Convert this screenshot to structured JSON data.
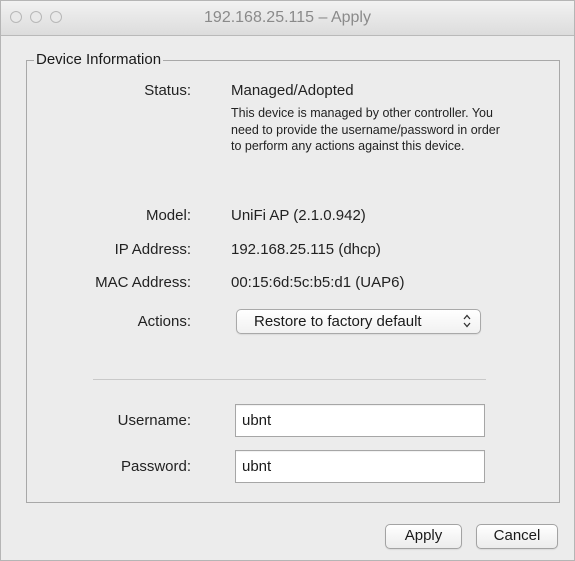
{
  "window": {
    "title": "192.168.25.115 – Apply"
  },
  "device_info": {
    "group_label": "Device Information",
    "status_label": "Status:",
    "status_value": "Managed/Adopted",
    "status_note": "This device is managed by other controller. You need to provide the username/password in order to perform any actions against this device.",
    "model_label": "Model:",
    "model_value": "UniFi AP (2.1.0.942)",
    "ip_label": "IP Address:",
    "ip_value": "192.168.25.115 (dhcp)",
    "mac_label": "MAC Address:",
    "mac_value": "00:15:6d:5c:b5:d1 (UAP6)",
    "actions_label": "Actions:",
    "actions_selected": "Restore to factory default"
  },
  "credentials": {
    "username_label": "Username:",
    "username_value": "ubnt",
    "password_label": "Password:",
    "password_value": "ubnt"
  },
  "buttons": {
    "apply": "Apply",
    "cancel": "Cancel"
  },
  "icons": {
    "close": "close-icon",
    "minimize": "minimize-icon",
    "zoom": "zoom-icon",
    "select_arrows": "chevron-up-down-icon"
  }
}
